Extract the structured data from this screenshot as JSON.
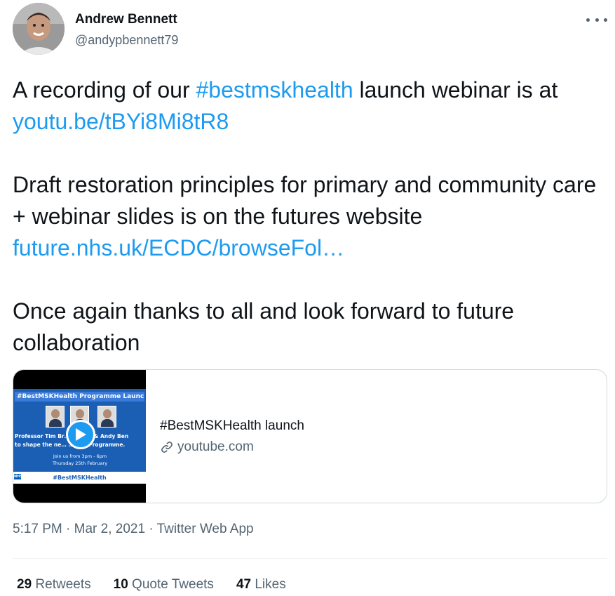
{
  "author": {
    "name": "Andrew Bennett",
    "handle": "@andypbennett79"
  },
  "tweet": {
    "line1_before": "A recording of our ",
    "hashtag": "#bestmskhealth",
    "line1_after": " launch webinar is at",
    "link1": "youtu.be/tBYi8Mi8tR8",
    "para2": "Draft restoration principles for primary and community care + webinar slides is on the futures website",
    "link2": "future.nhs.uk/ECDC/browseFol…",
    "para3": "Once again thanks to all and look forward to future collaboration"
  },
  "card": {
    "title": "#BestMSKHealth launch",
    "domain": "youtube.com",
    "thumbnail": {
      "banner": "#BestMSKHealth Programme Launch",
      "text_line1": "Professor Tim Br…    …ercer & Andy Ben",
      "text_line2": "to shape the ne…         …MSK Programme.",
      "when_line1": "Join us from 3pm - 6pm",
      "when_line2": "Thursday 25th February",
      "footer": "#BestMSKHealth",
      "nhs_logo": "NHS"
    }
  },
  "meta": {
    "time": "5:17 PM",
    "separator": " · ",
    "date": "Mar 2, 2021",
    "source": "Twitter Web App"
  },
  "stats": {
    "retweets_count": "29",
    "retweets_label": "Retweets",
    "quotes_count": "10",
    "quotes_label": "Quote Tweets",
    "likes_count": "47",
    "likes_label": "Likes"
  },
  "colors": {
    "link": "#1d9bf0",
    "text": "#0f1419",
    "secondary": "#536471"
  },
  "icons": {
    "more": "more-dots-icon",
    "link": "link-icon",
    "play": "play-icon"
  }
}
